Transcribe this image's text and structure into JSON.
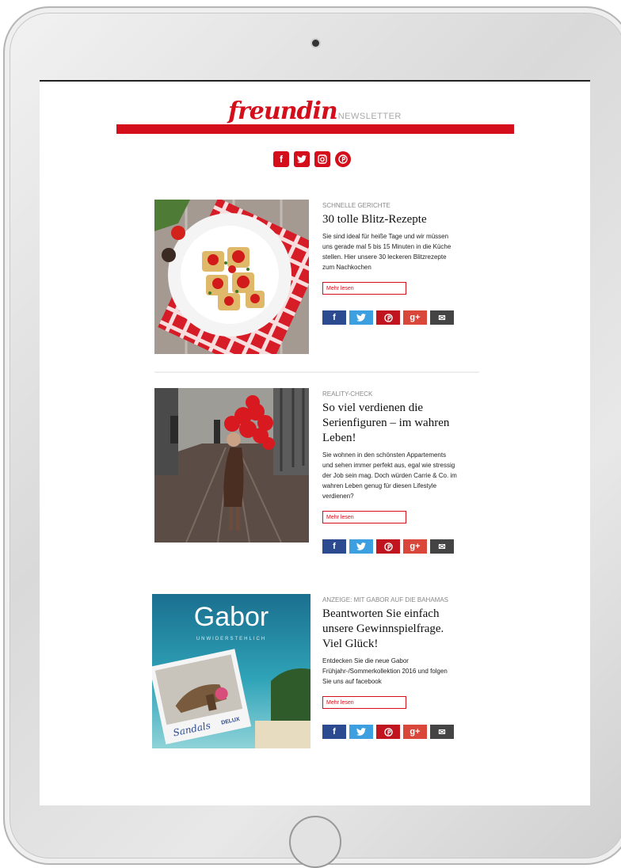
{
  "brand": {
    "logo": "freundin",
    "sub": "NEWSLETTER",
    "accent": "#d40f1b"
  },
  "social_top": [
    {
      "icon": "facebook-icon",
      "glyph": "f"
    },
    {
      "icon": "twitter-icon",
      "glyph": "t"
    },
    {
      "icon": "instagram-icon",
      "glyph": "◻"
    },
    {
      "icon": "pinterest-icon",
      "glyph": "p"
    }
  ],
  "articles": [
    {
      "kicker": "SCHNELLE GERICHTE",
      "headline": "30 tolle Blitz-Rezepte",
      "teaser": "Sie sind ideal für heiße Tage und wir müssen uns gerade mal 5 bis 15 Minuten in die Küche stellen. Hier unsere 30 leckeren Blitzrezepte zum Nachkochen",
      "more": "Mehr lesen"
    },
    {
      "kicker": "REALITY-CHECK",
      "headline": "So viel verdienen die Serienfiguren – im wahren Leben!",
      "teaser": "Sie wohnen in den schönsten Appartements und sehen immer perfekt aus, egal wie stressig der Job sein mag. Doch würden Carrie & Co. im wahren Leben genug für diesen Lifestyle verdienen?",
      "more": "Mehr lesen"
    },
    {
      "kicker": "ANZEIGE: MIT GABOR AUF DIE BAHAMAS",
      "headline": "Beantworten Sie einfach unsere Gewinnspielfrage. Viel Glück!",
      "teaser": "Entdecken Sie die neue Gabor Frühjahr-/Sommerkollektion 2016 und folgen Sie uns auf facebook",
      "more": "Mehr lesen"
    }
  ],
  "share": {
    "facebook": "f",
    "twitter": "t",
    "pinterest": "p",
    "googleplus": "g+",
    "mail": "✉"
  },
  "ad_image": {
    "brand": "Gabor",
    "tagline": "UNWIDERSTEHLICH",
    "caption": "Sandals",
    "badge": "DELUX"
  }
}
